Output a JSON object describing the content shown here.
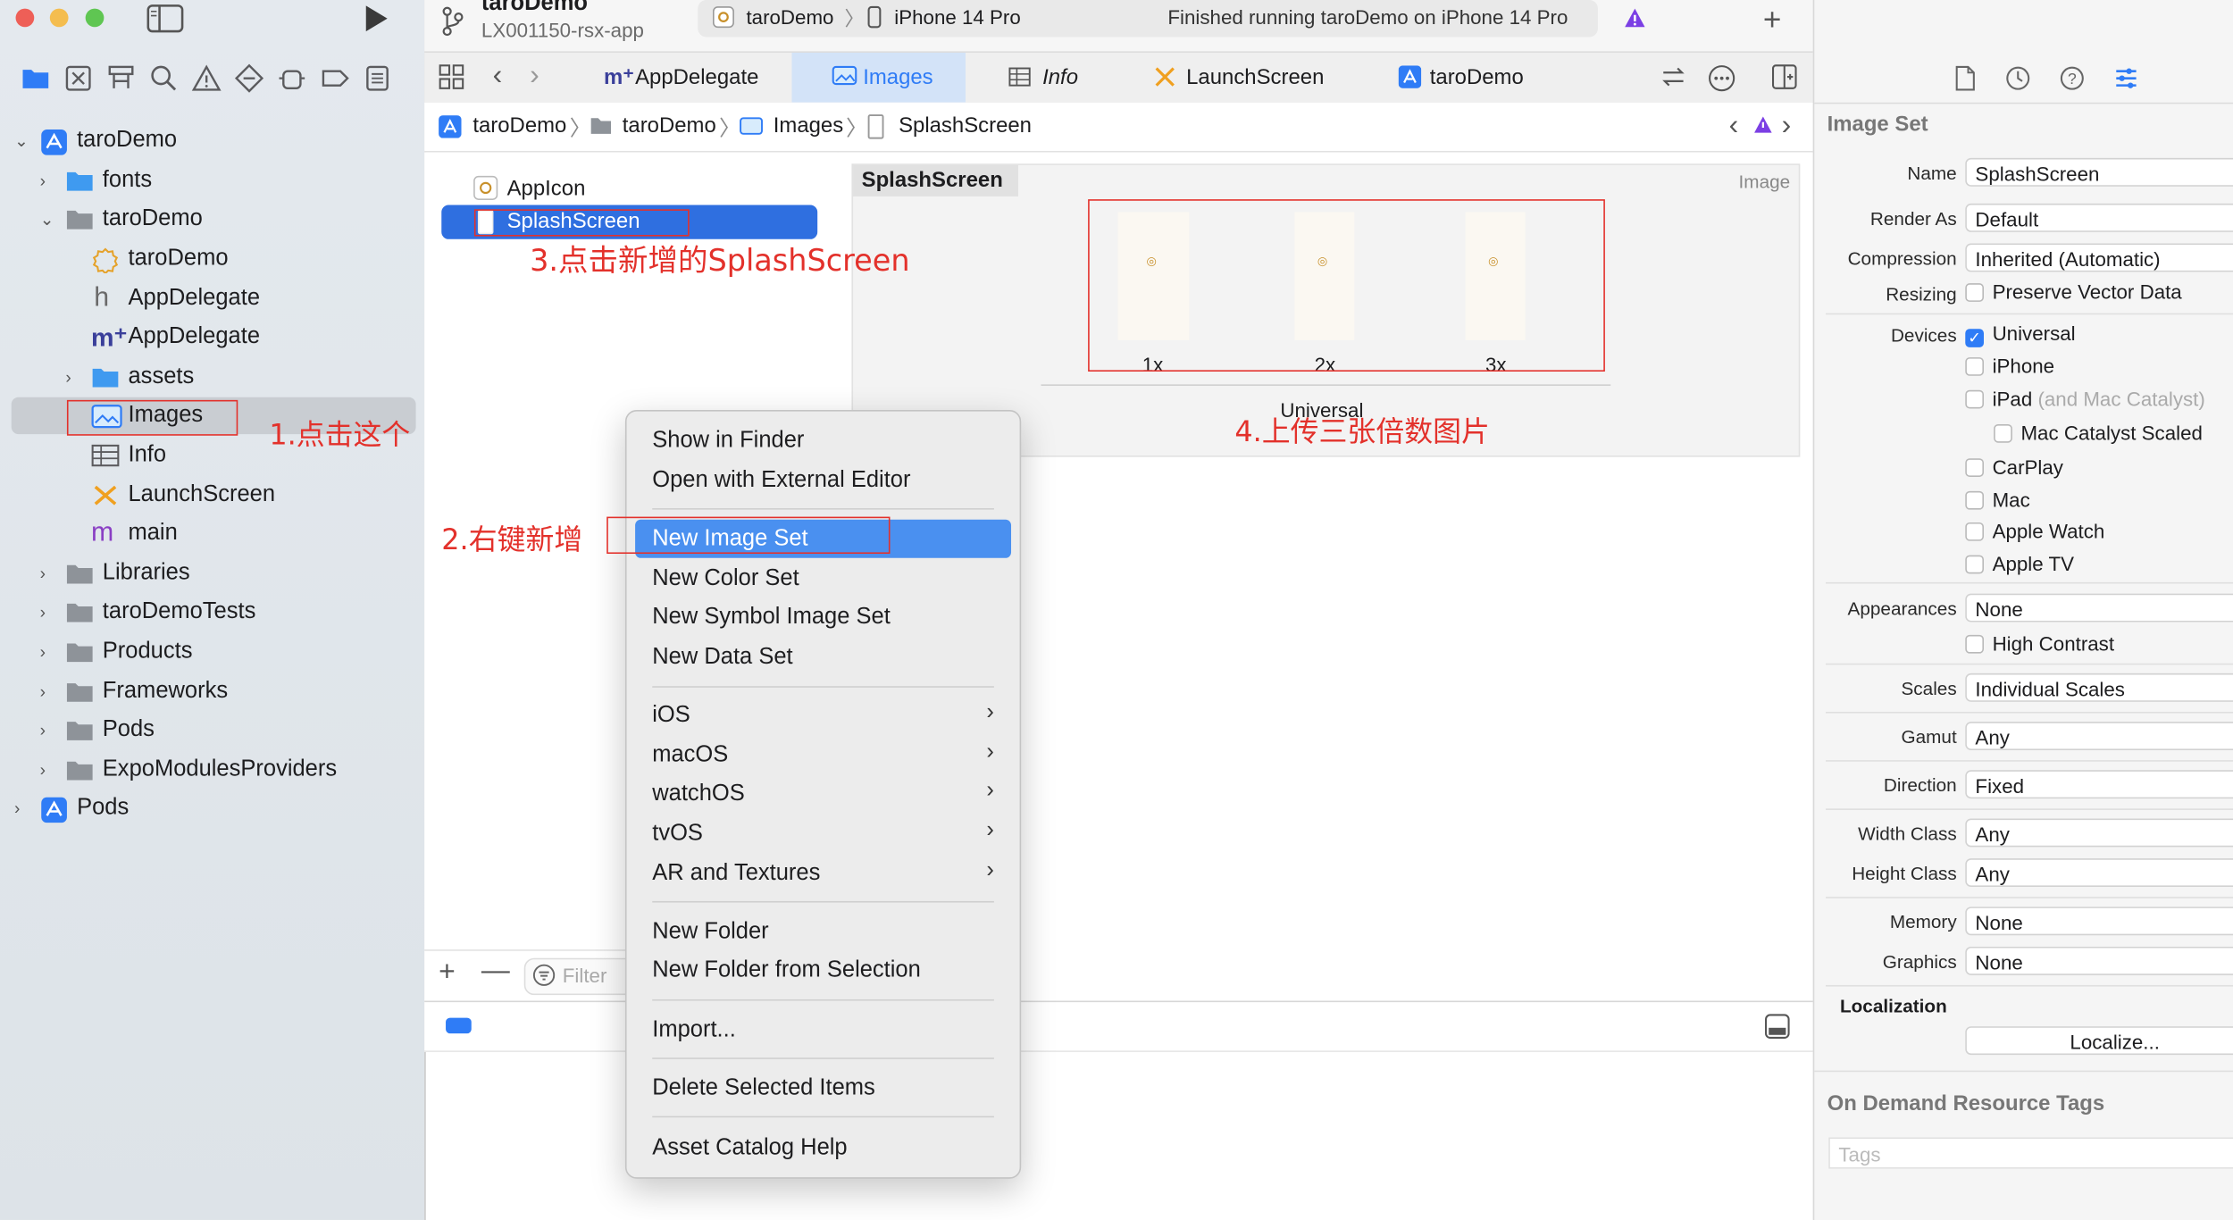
{
  "window": {
    "scheme_title": "taroDemo",
    "branch": "LX001150-rsx-app",
    "run_target": "taroDemo",
    "device": "iPhone 14 Pro",
    "status": "Finished running taroDemo on iPhone 14 Pro"
  },
  "navigator": {
    "items": [
      {
        "label": "taroDemo"
      },
      {
        "label": "fonts"
      },
      {
        "label": "taroDemo"
      },
      {
        "label": "taroDemo"
      },
      {
        "label": "AppDelegate"
      },
      {
        "label": "AppDelegate"
      },
      {
        "label": "assets"
      },
      {
        "label": "Images"
      },
      {
        "label": "Info"
      },
      {
        "label": "LaunchScreen"
      },
      {
        "label": "main"
      },
      {
        "label": "Libraries"
      },
      {
        "label": "taroDemoTests"
      },
      {
        "label": "Products"
      },
      {
        "label": "Frameworks"
      },
      {
        "label": "Pods"
      },
      {
        "label": "ExpoModulesProviders"
      },
      {
        "label": "Pods"
      }
    ]
  },
  "tabs": [
    {
      "label": "AppDelegate"
    },
    {
      "label": "Images"
    },
    {
      "label": "Info"
    },
    {
      "label": "LaunchScreen"
    },
    {
      "label": "taroDemo"
    }
  ],
  "jumpbar": [
    "taroDemo",
    "taroDemo",
    "Images",
    "SplashScreen"
  ],
  "assets": {
    "items": [
      {
        "label": "AppIcon"
      },
      {
        "label": "SplashScreen"
      }
    ],
    "filter_placeholder": "Filter"
  },
  "canvas": {
    "set_name": "SplashScreen",
    "kind": "Image",
    "slots": [
      "1x",
      "2x",
      "3x"
    ],
    "group_label": "Universal"
  },
  "context_menu": {
    "items": [
      "Show in Finder",
      "Open with External Editor",
      "New Image Set",
      "New Color Set",
      "New Symbol Image Set",
      "New Data Set",
      "iOS",
      "macOS",
      "watchOS",
      "tvOS",
      "AR and Textures",
      "New Folder",
      "New Folder from Selection",
      "Import...",
      "Delete Selected Items",
      "Asset Catalog Help"
    ]
  },
  "inspector": {
    "title": "Image Set",
    "name_label": "Name",
    "name_value": "SplashScreen",
    "render_label": "Render As",
    "render_value": "Default",
    "compression_label": "Compression",
    "compression_value": "Inherited (Automatic)",
    "resizing_label": "Resizing",
    "resizing_value": "Preserve Vector Data",
    "devices_label": "Devices",
    "devices": [
      "Universal",
      "iPhone",
      "iPad",
      "Mac Catalyst Scaled",
      "CarPlay",
      "Mac",
      "Apple Watch",
      "Apple TV"
    ],
    "ipad_suffix": "(and Mac Catalyst)",
    "appearances_label": "Appearances",
    "appearances_value": "None",
    "high_contrast": "High Contrast",
    "scales_label": "Scales",
    "scales_value": "Individual Scales",
    "gamut_label": "Gamut",
    "gamut_value": "Any",
    "direction_label": "Direction",
    "direction_value": "Fixed",
    "width_label": "Width Class",
    "width_value": "Any",
    "height_label": "Height Class",
    "height_value": "Any",
    "memory_label": "Memory",
    "memory_value": "None",
    "graphics_label": "Graphics",
    "graphics_value": "None",
    "localization_title": "Localization",
    "localize_button": "Localize...",
    "odr_title": "On Demand Resource Tags",
    "tags_placeholder": "Tags"
  },
  "annotations": {
    "step1": "1.点击这个",
    "step2": "2.右键新增",
    "step3": "3.点击新增的SplashScreen",
    "step4": "4.上传三张倍数图片"
  },
  "colors": {
    "selection": "#2f6fe0",
    "menu_highlight": "#4a90f0",
    "annotation": "#e3312b",
    "folder": "#3f9af0"
  }
}
